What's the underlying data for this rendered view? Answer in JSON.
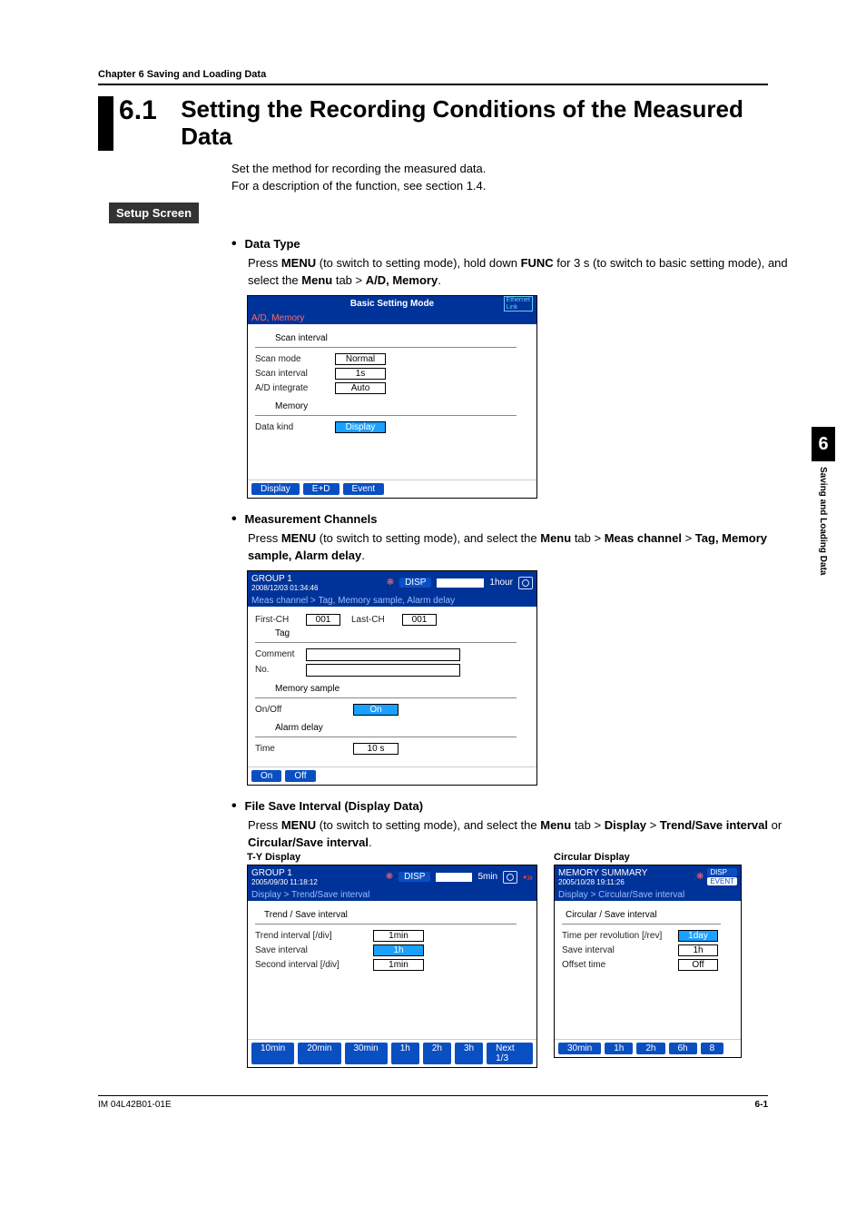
{
  "chapter_header": "Chapter 6    Saving and Loading Data",
  "section_number": "6.1",
  "section_title": "Setting the Recording Conditions of the Measured Data",
  "intro_line1": "Set the method for recording the measured data.",
  "intro_line2": "For a description of the function, see section 1.4.",
  "setup_screen": "Setup Screen",
  "data_type": {
    "heading": "Data Type",
    "body1": "Press ",
    "menu": "MENU",
    "body2": " (to switch to setting mode), hold down ",
    "func": "FUNC",
    "body3": " for 3 s (to switch to basic setting mode), and select the ",
    "menutab": "Menu",
    "body4": " tab > ",
    "admem": "A/D, Memory",
    "body5": "."
  },
  "ss1": {
    "title_center": "Basic Setting Mode",
    "eth": "Ethernet\nLink",
    "crumb": "A/D, Memory",
    "grp1": "Scan interval",
    "scan_mode_l": "Scan mode",
    "scan_mode_v": "Normal",
    "scan_int_l": "Scan interval",
    "scan_int_v": "1s",
    "adint_l": "A/D integrate",
    "adint_v": "Auto",
    "grp2": "Memory",
    "kind_l": "Data kind",
    "kind_v": "Display",
    "btn1": "Display",
    "btn2": "E+D",
    "btn3": "Event"
  },
  "meas": {
    "heading": "Measurement Channels",
    "body1": "Press ",
    "menu": "MENU",
    "body2": " (to switch to setting mode), and select the ",
    "menutab": "Menu",
    "body3": " tab > ",
    "mc": "Meas channel",
    "body4": " > ",
    "tmad": "Tag, Memory sample, Alarm delay",
    "body5": "."
  },
  "ss2": {
    "group": "GROUP 1",
    "ts": "2008/12/03 01:34:46",
    "disp": "DISP",
    "interval": "1hour",
    "crumb": "Meas channel > Tag, Memory sample, Alarm delay",
    "first_l": "First-CH",
    "first_v": "001",
    "last_l": "Last-CH",
    "last_v": "001",
    "tag": "Tag",
    "comment_l": "Comment",
    "no_l": "No.",
    "mem": "Memory sample",
    "onoff_l": "On/Off",
    "onoff_v": "On",
    "adelay": "Alarm delay",
    "time_l": "Time",
    "time_v": "10 s",
    "btn1": "On",
    "btn2": "Off"
  },
  "fsi": {
    "heading": "File Save Interval (Display Data)",
    "body1": "Press ",
    "menu": "MENU",
    "body2": " (to switch to setting mode), and select the ",
    "menutab": "Menu",
    "body3": " tab > ",
    "disp": "Display",
    "body4": " > ",
    "trend": "Trend/Save interval",
    "or": " or ",
    "circ": "Circular/Save interval",
    "body5": "."
  },
  "ty_head": "T-Y Display",
  "circ_head": "Circular Display",
  "ss3": {
    "group": "GROUP 1",
    "ts": "2005/09/30 11:18:12",
    "disp": "DISP",
    "interval": "5min",
    "crumb": "Display > Trend/Save interval",
    "grp": "Trend / Save interval",
    "ti_l": "Trend interval [/div]",
    "ti_v": "1min",
    "si_l": "Save interval",
    "si_v": "1h",
    "sec_l": "Second interval [/div]",
    "sec_v": "1min",
    "btns": [
      "10min",
      "20min",
      "30min",
      "1h",
      "2h",
      "3h",
      "Next 1/3"
    ]
  },
  "ss4": {
    "title": "MEMORY SUMMARY",
    "ts": "2005/10/28 19:11:26",
    "disp": "DISP",
    "event": "EVENT",
    "crumb": "Display > Circular/Save interval",
    "grp": "Circular / Save interval",
    "tpr_l": "Time per revolution [/rev]",
    "tpr_v": "1day",
    "si_l": "Save interval",
    "si_v": "1h",
    "off_l": "Offset time",
    "off_v": "Off",
    "btns": [
      "30min",
      "1h",
      "2h",
      "6h",
      "8"
    ]
  },
  "sidebar": {
    "chnum": "6",
    "chlabel": "Saving and Loading Data"
  },
  "footer": {
    "left": "IM 04L42B01-01E",
    "right": "6-1"
  }
}
